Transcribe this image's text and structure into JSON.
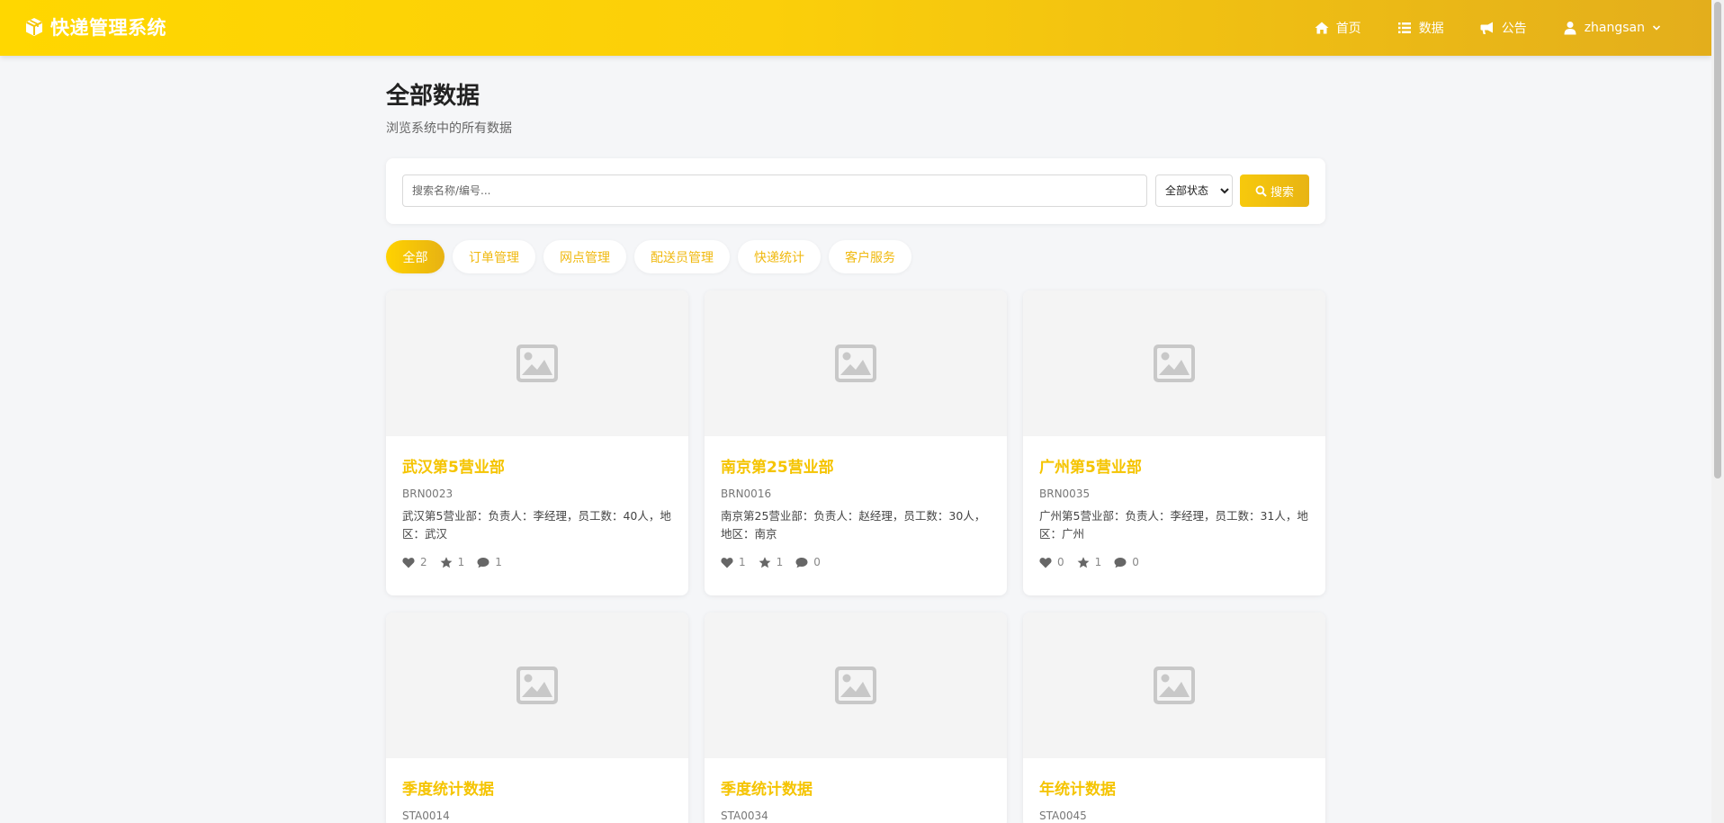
{
  "header": {
    "brand_icon": "cube-icon",
    "brand_title": "快递管理系统",
    "nav": [
      {
        "icon": "home-icon",
        "label": "首页"
      },
      {
        "icon": "list-icon",
        "label": "数据"
      },
      {
        "icon": "megaphone-icon",
        "label": "公告"
      }
    ],
    "user": {
      "icon": "user-icon",
      "name": "zhangsan"
    }
  },
  "page": {
    "title": "全部数据",
    "subtitle": "浏览系统中的所有数据"
  },
  "search": {
    "placeholder": "搜索名称/编号...",
    "status_selected": "全部状态",
    "button_label": "搜索"
  },
  "filters": [
    {
      "label": "全部",
      "active": true
    },
    {
      "label": "订单管理",
      "active": false
    },
    {
      "label": "网点管理",
      "active": false
    },
    {
      "label": "配送员管理",
      "active": false
    },
    {
      "label": "快递统计",
      "active": false
    },
    {
      "label": "客户服务",
      "active": false
    }
  ],
  "cards": [
    {
      "title": "武汉第5营业部",
      "code": "BRN0023",
      "desc": "武汉第5营业部：负责人：李经理，员工数：40人，地区：武汉",
      "likes": "2",
      "stars": "1",
      "comments": "1"
    },
    {
      "title": "南京第25营业部",
      "code": "BRN0016",
      "desc": "南京第25营业部：负责人：赵经理，员工数：30人，地区：南京",
      "likes": "1",
      "stars": "1",
      "comments": "0"
    },
    {
      "title": "广州第5营业部",
      "code": "BRN0035",
      "desc": "广州第5营业部：负责人：李经理，员工数：31人，地区：广州",
      "likes": "0",
      "stars": "1",
      "comments": "0"
    },
    {
      "title": "季度统计数据",
      "code": "STA0014",
      "desc": "",
      "likes": "",
      "stars": "",
      "comments": ""
    },
    {
      "title": "季度统计数据",
      "code": "STA0034",
      "desc": "",
      "likes": "",
      "stars": "",
      "comments": ""
    },
    {
      "title": "年统计数据",
      "code": "STA0045",
      "desc": "",
      "likes": "",
      "stars": "",
      "comments": ""
    }
  ],
  "colors": {
    "accent": "#ffd200",
    "accent_dark": "#e3ae1c",
    "title_text": "#f5c400",
    "background": "#f5f6f8"
  }
}
